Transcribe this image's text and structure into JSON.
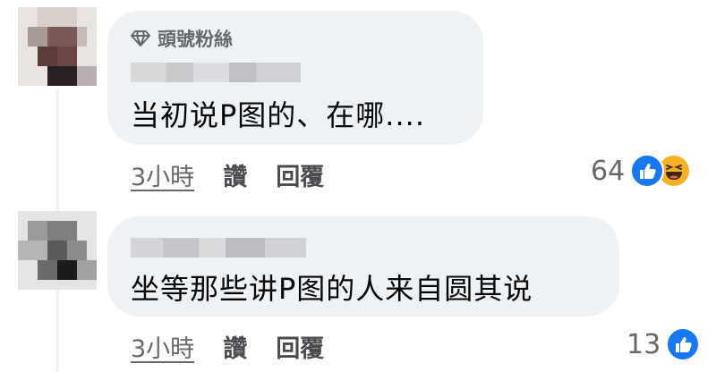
{
  "comments": [
    {
      "badge": "頭號粉絲",
      "text": "当初说P图的、在哪....",
      "time": "3小時",
      "like_label": "讚",
      "reply_label": "回覆",
      "reaction_count": "64",
      "reactions": [
        "like-icon",
        "haha-icon"
      ]
    },
    {
      "text": "坐等那些讲P图的人来自圆其说",
      "time": "3小時",
      "like_label": "讚",
      "reply_label": "回覆",
      "reaction_count": "13",
      "reactions": [
        "like-icon"
      ]
    }
  ],
  "colors": {
    "bubble": "#eff2f5",
    "like_blue": "#1877f2",
    "haha_yellow": "#f7b125",
    "secondary_text": "#65676b"
  }
}
